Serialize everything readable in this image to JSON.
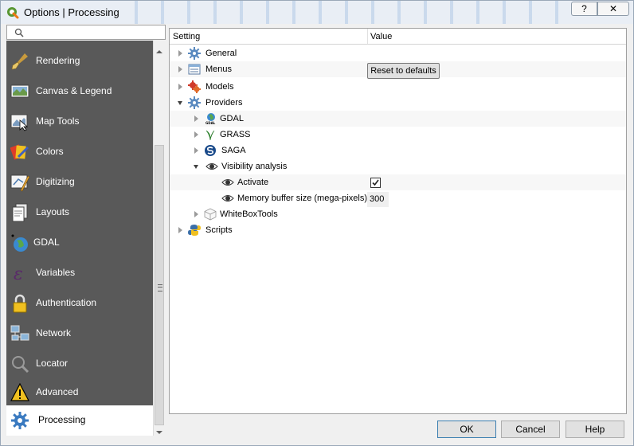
{
  "window": {
    "title": "Options | Processing",
    "help_button": "?",
    "close_button": "✕"
  },
  "search": {
    "value": "",
    "placeholder": ""
  },
  "sidebar": {
    "items": [
      {
        "label": "Rendering",
        "icon": "brush-icon",
        "selected": false
      },
      {
        "label": "Canvas & Legend",
        "icon": "canvas-icon",
        "selected": false
      },
      {
        "label": "Map Tools",
        "icon": "map-tools-icon",
        "selected": false
      },
      {
        "label": "Colors",
        "icon": "palette-icon",
        "selected": false
      },
      {
        "label": "Digitizing",
        "icon": "digitizing-icon",
        "selected": false
      },
      {
        "label": "Layouts",
        "icon": "layouts-icon",
        "selected": false
      },
      {
        "label": "GDAL",
        "icon": "gdal-globe-icon",
        "selected": false
      },
      {
        "label": "Variables",
        "icon": "variables-icon",
        "selected": false
      },
      {
        "label": "Authentication",
        "icon": "lock-icon",
        "selected": false
      },
      {
        "label": "Network",
        "icon": "network-icon",
        "selected": false
      },
      {
        "label": "Locator",
        "icon": "magnifier-icon",
        "selected": false
      },
      {
        "label": "Advanced",
        "icon": "warning-icon",
        "selected": false
      },
      {
        "label": "Processing",
        "icon": "gear-icon",
        "selected": true
      }
    ]
  },
  "tree": {
    "header_setting": "Setting",
    "header_value": "Value",
    "rows": [
      {
        "label": "General",
        "icon": "gear-icon",
        "expander": "closed"
      },
      {
        "label": "Menus",
        "icon": "menu-icon",
        "expander": "closed",
        "button": "Reset to defaults"
      },
      {
        "label": "Models",
        "icon": "models-icon",
        "expander": "closed"
      },
      {
        "label": "Providers",
        "icon": "gear-icon",
        "expander": "open"
      },
      {
        "label": "GDAL",
        "icon": "gdal-icon",
        "expander": "closed"
      },
      {
        "label": "GRASS",
        "icon": "grass-icon",
        "expander": "closed"
      },
      {
        "label": "SAGA",
        "icon": "saga-icon",
        "expander": "closed"
      },
      {
        "label": "Visibility analysis",
        "icon": "eye-icon",
        "expander": "open"
      },
      {
        "label": "Activate",
        "icon": "eye-icon",
        "checked": true
      },
      {
        "label": "Memory buffer size (mega-pixels)",
        "icon": "eye-icon",
        "value": "300"
      },
      {
        "label": "WhiteBoxTools",
        "icon": "cube-icon",
        "expander": "closed"
      },
      {
        "label": "Scripts",
        "icon": "python-icon",
        "expander": "closed"
      }
    ]
  },
  "footer": {
    "ok": "OK",
    "cancel": "Cancel",
    "help": "Help"
  },
  "colors": {
    "sidebar_bg": "#595959",
    "accent": "#3c7fb1",
    "qgis_green": "#589632"
  }
}
